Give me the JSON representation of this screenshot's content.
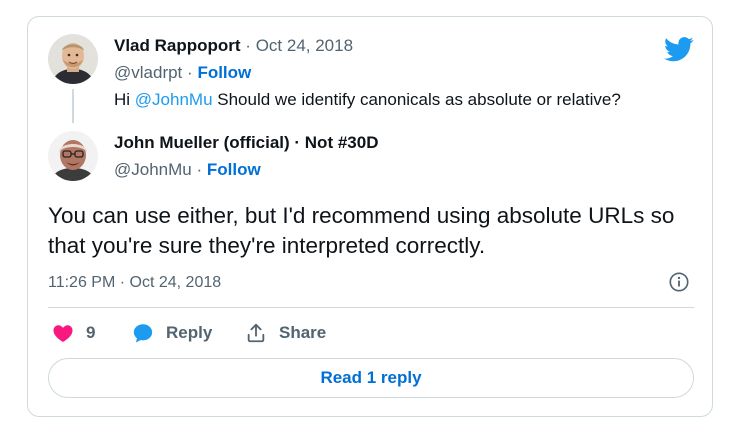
{
  "parent_tweet": {
    "author_name": "Vlad Rappoport",
    "separator": "·",
    "date": "Oct 24, 2018",
    "handle": "@vladrpt",
    "follow_label": "Follow",
    "text_prefix": "Hi ",
    "mention": "@JohnMu",
    "text_suffix": " Should we identify canonicals as absolute or relative?"
  },
  "reply_tweet": {
    "author_name": "John Mueller (official) · Not #30D",
    "handle": "@JohnMu",
    "separator": "·",
    "follow_label": "Follow",
    "text": "You can use either, but I'd recommend using absolute URLs so that you're sure they're interpreted correctly.",
    "timestamp": "11:26 PM · Oct 24, 2018"
  },
  "actions": {
    "like_count": "9",
    "reply_label": "Reply",
    "share_label": "Share"
  },
  "read_replies_label": "Read 1 reply",
  "colors": {
    "twitter_blue": "#1d9bf0",
    "like_pink": "#f91880",
    "border": "#cfd9de",
    "muted_text": "#536471",
    "follow_blue": "#006fd6"
  },
  "icons": [
    "twitter-bird-icon",
    "info-icon",
    "heart-icon",
    "reply-bubble-icon",
    "share-icon"
  ]
}
